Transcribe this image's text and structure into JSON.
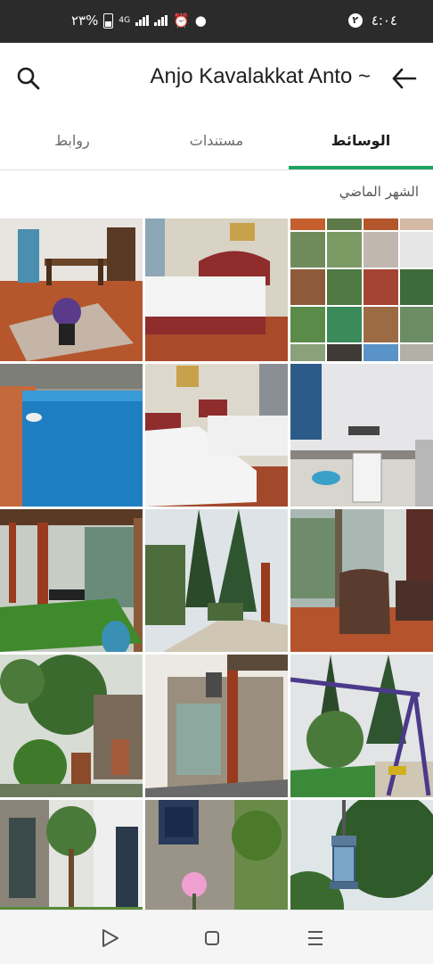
{
  "status_bar": {
    "time": "٤:٠٤",
    "notification_count": "٢",
    "battery": "٢٣%",
    "network": "4G"
  },
  "app_bar": {
    "title": "Anjo Kavalakkat Anto ~"
  },
  "tabs": [
    {
      "label": "الوسائط",
      "active": true
    },
    {
      "label": "مستندات",
      "active": false
    },
    {
      "label": "روابط",
      "active": false
    }
  ],
  "section": {
    "label": "الشهر الماضي"
  },
  "colors": {
    "accent": "#1ea362",
    "status_bar": "#2b2b2b"
  },
  "media_items": [
    {
      "subject": "living room with dining table and flowers"
    },
    {
      "subject": "bedroom with double bed"
    },
    {
      "subject": "collage of garden and rooms"
    },
    {
      "subject": "indoor swimming pool"
    },
    {
      "subject": "bedroom with two single beds"
    },
    {
      "subject": "kitchen"
    },
    {
      "subject": "pergola with artificial grass"
    },
    {
      "subject": "garden with pine trees"
    },
    {
      "subject": "sitting area with armchair"
    },
    {
      "subject": "garden with trees and fireplace"
    },
    {
      "subject": "stone outbuilding with lantern"
    },
    {
      "subject": "garden swing"
    },
    {
      "subject": "house exterior with tree"
    },
    {
      "subject": "stone wall with flowers"
    },
    {
      "subject": "lantern hanging in tree"
    }
  ]
}
